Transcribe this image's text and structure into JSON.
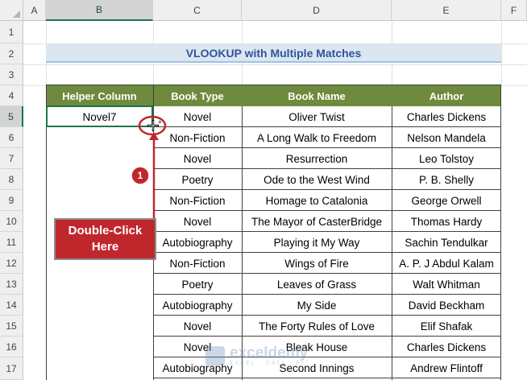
{
  "column_headers": [
    "A",
    "B",
    "C",
    "D",
    "E",
    "F"
  ],
  "selected_column": "B",
  "row_numbers": [
    "1",
    "2",
    "3",
    "4",
    "5",
    "6",
    "7",
    "8",
    "9",
    "10",
    "11",
    "12",
    "13",
    "14",
    "15",
    "16",
    "17"
  ],
  "selected_row": "5",
  "title": "VLOOKUP with Multiple Matches",
  "table": {
    "headers": [
      "Helper Column",
      "Book Type",
      "Book Name",
      "Author"
    ],
    "rows": [
      {
        "helper": "Novel7",
        "type": "Novel",
        "name": "Oliver Twist",
        "author": "Charles Dickens"
      },
      {
        "helper": "",
        "type": "Non-Fiction",
        "name": "A Long Walk to Freedom",
        "author": "Nelson Mandela"
      },
      {
        "helper": "",
        "type": "Novel",
        "name": "Resurrection",
        "author": "Leo Tolstoy"
      },
      {
        "helper": "",
        "type": "Poetry",
        "name": "Ode to the West Wind",
        "author": "P. B. Shelly"
      },
      {
        "helper": "",
        "type": "Non-Fiction",
        "name": "Homage to Catalonia",
        "author": "George Orwell"
      },
      {
        "helper": "",
        "type": "Novel",
        "name": "The Mayor of CasterBridge",
        "author": "Thomas Hardy"
      },
      {
        "helper": "",
        "type": "Autobiography",
        "name": "Playing it My Way",
        "author": "Sachin Tendulkar"
      },
      {
        "helper": "",
        "type": "Non-Fiction",
        "name": "Wings of Fire",
        "author": "A. P. J Abdul Kalam"
      },
      {
        "helper": "",
        "type": "Poetry",
        "name": "Leaves of Grass",
        "author": "Walt Whitman"
      },
      {
        "helper": "",
        "type": "Autobiography",
        "name": "My Side",
        "author": "David Beckham"
      },
      {
        "helper": "",
        "type": "Novel",
        "name": "The Forty Rules of Love",
        "author": "Elif Shafak"
      },
      {
        "helper": "",
        "type": "Novel",
        "name": "Bleak House",
        "author": "Charles Dickens"
      },
      {
        "helper": "",
        "type": "Autobiography",
        "name": "Second Innings",
        "author": "Andrew Flintoff"
      }
    ]
  },
  "annotation": {
    "step_number": "1",
    "callout_line1": "Double-Click",
    "callout_line2": "Here"
  },
  "watermark": {
    "brand": "exceldemy",
    "tagline": "EXCEL · DATA · BI"
  },
  "colors": {
    "header_green": "#6e8b3d",
    "title_fill": "#dce6f1",
    "title_text": "#2f5597",
    "callout_red": "#c0272d",
    "selection_green": "#217346"
  }
}
